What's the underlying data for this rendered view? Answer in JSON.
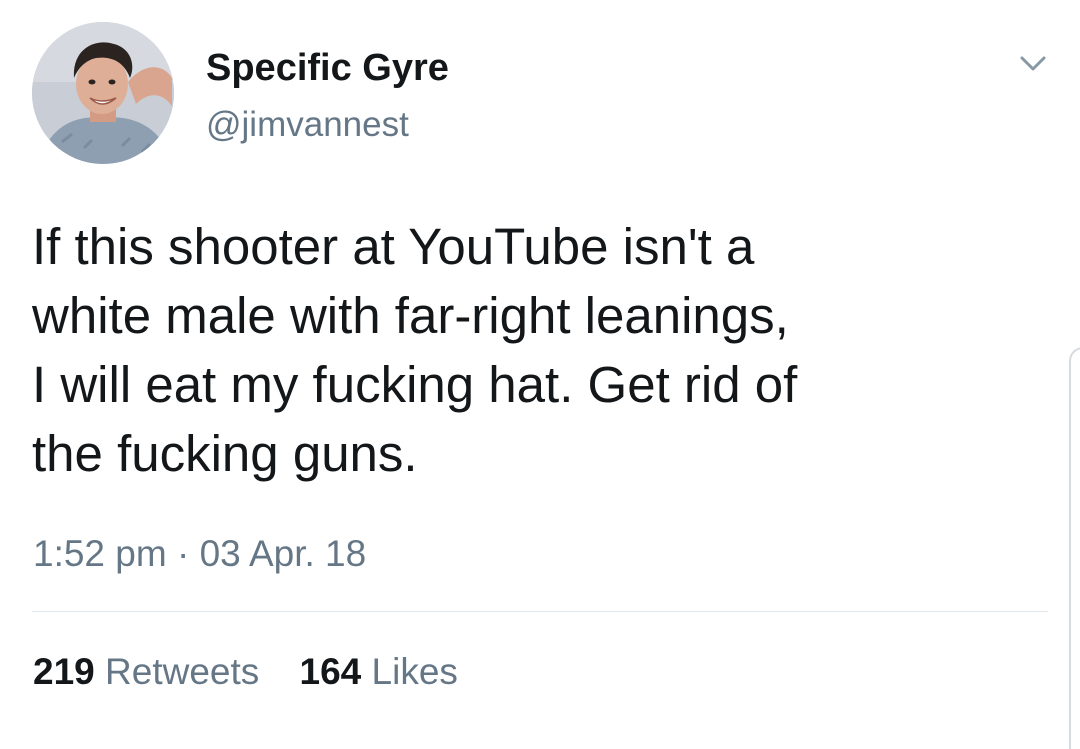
{
  "author": {
    "display_name": "Specific Gyre",
    "handle": "@jimvannest",
    "avatar_icon": "profile-photo"
  },
  "menu_icon": "chevron-down-icon",
  "tweet": {
    "lines": [
      "If this shooter at YouTube isn't a",
      "white male with far-right leanings,",
      "I will eat my fucking hat. Get rid of",
      "the fucking guns."
    ],
    "timestamp": "1:52 pm · 03 Apr. 18"
  },
  "stats": {
    "retweets_count": "219",
    "retweets_label": "Retweets",
    "likes_count": "164",
    "likes_label": "Likes"
  },
  "colors": {
    "text_primary": "#14171a",
    "text_secondary": "#657786",
    "divider": "#e1e8ed"
  }
}
